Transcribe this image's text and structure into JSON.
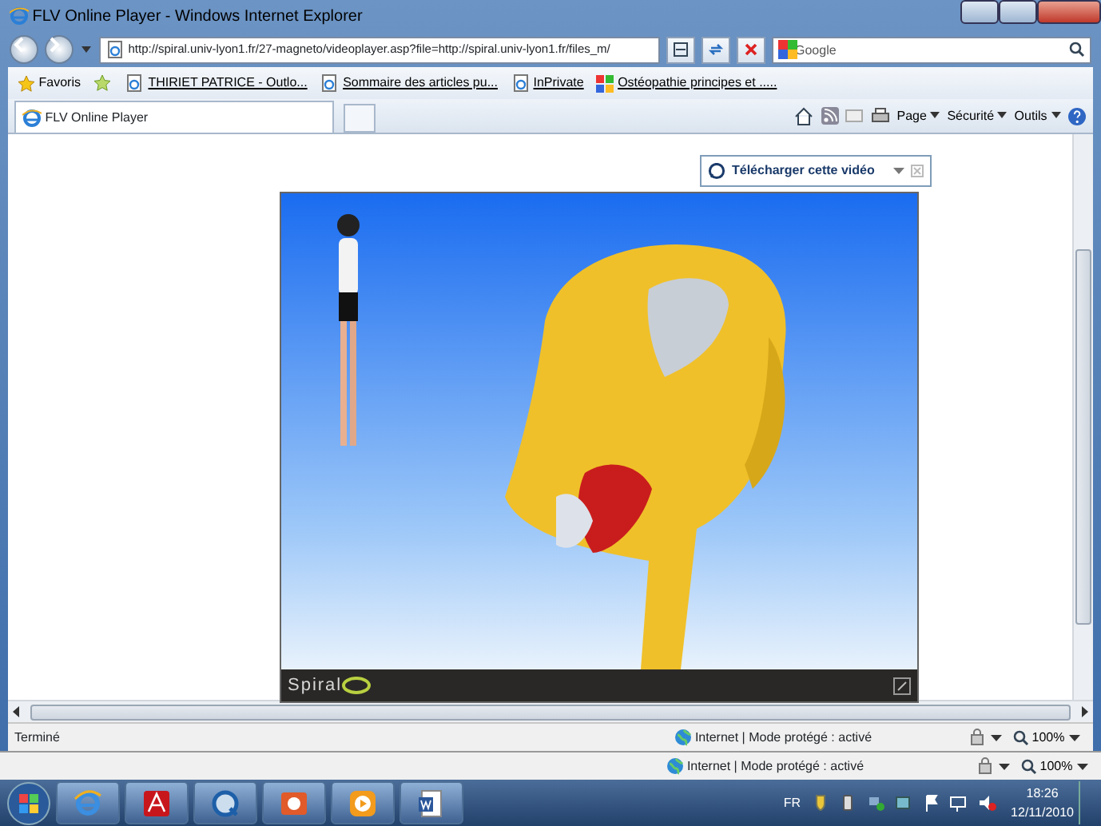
{
  "window": {
    "title": "FLV Online Player - Windows Internet Explorer"
  },
  "address_bar": {
    "url": "http://spiral.univ-lyon1.fr/27-magneto/videoplayer.asp?file=http://spiral.univ-lyon1.fr/files_m/"
  },
  "search": {
    "placeholder": "Google"
  },
  "favorites": {
    "button": "Favoris",
    "links": [
      {
        "label": "THIRIET PATRICE - Outlo...",
        "kind": "page"
      },
      {
        "label": "Sommaire des articles pu...",
        "kind": "page"
      },
      {
        "label": "InPrivate",
        "kind": "page"
      },
      {
        "label": "Ostéopathie principes et .....",
        "kind": "google"
      }
    ]
  },
  "tabs": [
    {
      "label": "FLV Online Player",
      "selected": true
    }
  ],
  "command_bar": [
    "Page",
    "Sécurité",
    "Outils"
  ],
  "download_badge": {
    "label": "Télécharger cette vidéo"
  },
  "player": {
    "logo": "Spiral"
  },
  "status_bar": {
    "text": "Terminé",
    "zone": "Internet | Mode protégé : activé",
    "zoom": "100%"
  },
  "status_bar_behind": {
    "zone": "Internet | Mode protégé : activé",
    "zoom": "100%"
  },
  "taskbar": {
    "apps": [
      {
        "kind": "ie"
      },
      {
        "kind": "acrobat"
      },
      {
        "kind": "quicktime"
      },
      {
        "kind": "powerpoint"
      },
      {
        "kind": "media"
      },
      {
        "kind": "word"
      }
    ],
    "language": "FR",
    "time": "18:26",
    "date": "12/11/2010"
  }
}
